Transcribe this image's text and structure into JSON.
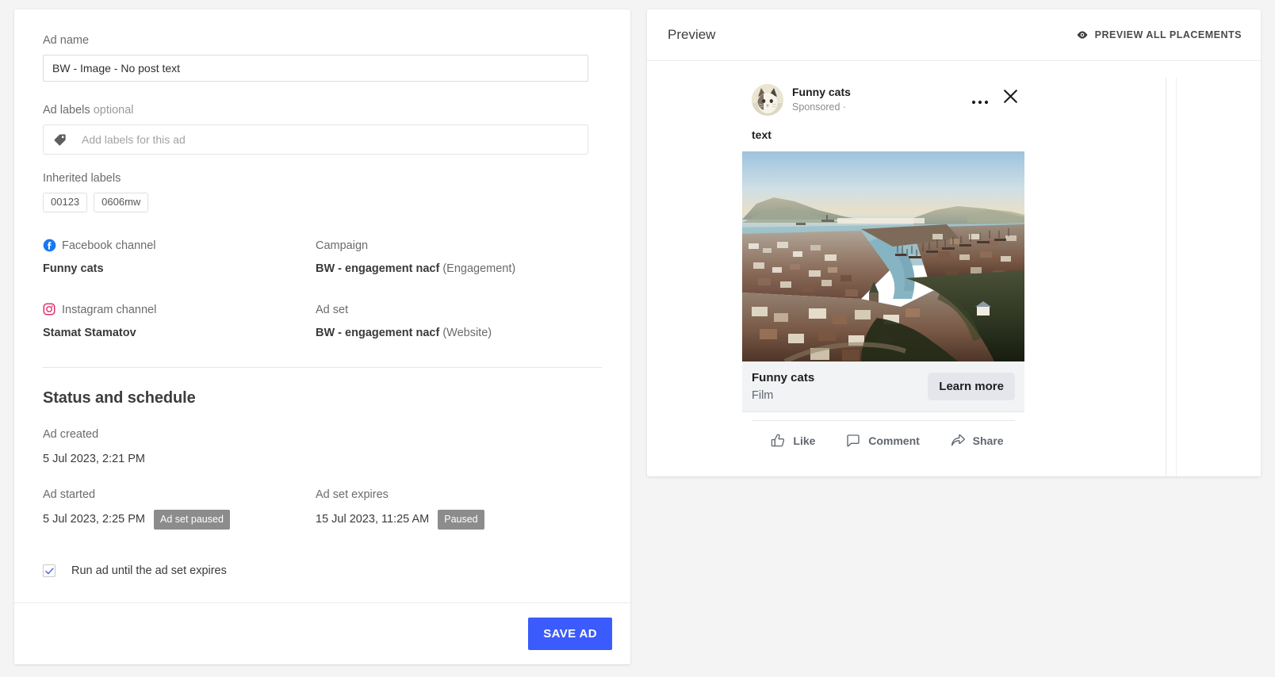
{
  "edit": {
    "ad_name": {
      "label": "Ad name",
      "value": "BW - Image - No post text"
    },
    "ad_labels": {
      "label": "Ad labels",
      "optional": "optional",
      "placeholder": "Add labels for this ad",
      "icon": "tag-icon"
    },
    "inherited_labels": {
      "label": "Inherited labels",
      "chips": [
        "00123",
        "0606mw"
      ]
    },
    "channels": [
      {
        "icon": "facebook-icon",
        "label": "Facebook channel",
        "value": "Funny cats"
      },
      {
        "icon": "instagram-icon",
        "label": "Instagram channel",
        "value": "Stamat Stamatov"
      }
    ],
    "campaign": {
      "label": "Campaign",
      "value": "BW - engagement nacf",
      "suffix": "(Engagement)"
    },
    "ad_set": {
      "label": "Ad set",
      "value": "BW - engagement nacf",
      "suffix": "(Website)"
    },
    "status_section": {
      "title": "Status and schedule",
      "ad_created": {
        "label": "Ad created",
        "value": "5 Jul 2023, 2:21 PM"
      },
      "ad_started": {
        "label": "Ad started",
        "value": "5 Jul 2023, 2:25 PM",
        "badge": "Ad set paused"
      },
      "ad_set_expires": {
        "label": "Ad set expires",
        "value": "15 Jul 2023, 11:25 AM",
        "badge": "Paused"
      }
    },
    "run_until_checkbox": {
      "label": "Run ad until the ad set expires",
      "checked": true
    },
    "save_label": "SAVE AD"
  },
  "preview": {
    "title": "Preview",
    "preview_all_label": "PREVIEW ALL PLACEMENTS",
    "preview_all_icon": "eye-icon",
    "ad": {
      "page_name": "Funny cats",
      "sponsored": "Sponsored ·",
      "avatar_alt": "cat-avatar",
      "post_text": "text",
      "more_icon": "ellipsis-icon",
      "close_icon": "close-icon",
      "cta": {
        "title": "Funny cats",
        "subtitle": "Film",
        "button": "Learn more"
      },
      "actions": [
        {
          "icon": "thumbs-up-icon",
          "label": "Like"
        },
        {
          "icon": "comment-bubble-icon",
          "label": "Comment"
        },
        {
          "icon": "share-arrow-icon",
          "label": "Share"
        }
      ]
    }
  },
  "colors": {
    "accent": "#3b5bfd",
    "badge": "#8c8c8c",
    "facebook": "#1877f2",
    "instagram": "#e1306c",
    "page_bg": "#f4f4f4"
  }
}
